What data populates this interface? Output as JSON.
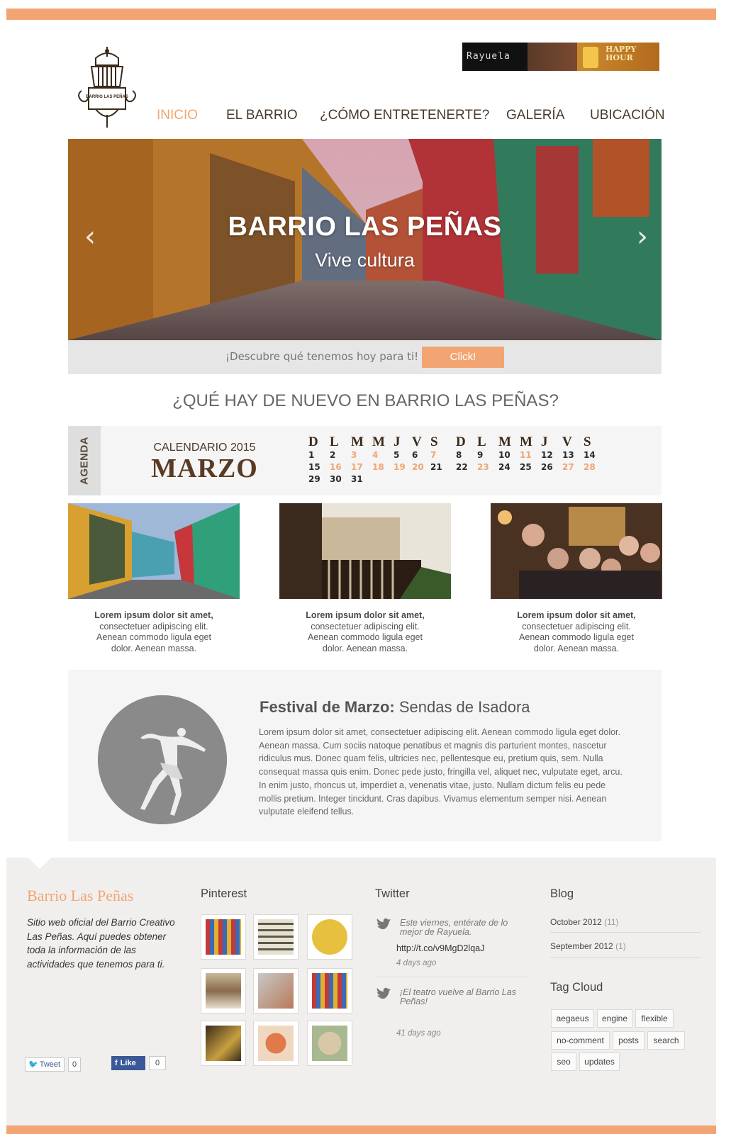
{
  "nav": {
    "items": [
      {
        "label": "INICIO",
        "active": true
      },
      {
        "label": "EL BARRIO",
        "active": false
      },
      {
        "label": "¿CÓMO ENTRETENERTE?",
        "active": false
      },
      {
        "label": "GALERÍA",
        "active": false
      },
      {
        "label": "UBICACIÓN",
        "active": false
      }
    ]
  },
  "logo": {
    "text": "BARRIO LAS PEÑAS"
  },
  "ad": {
    "brand": "Rayuela",
    "text": "HAPPY HOUR"
  },
  "hero": {
    "title": "BARRIO LAS PEÑAS",
    "subtitle": "Vive cultura",
    "prev_icon": "‹",
    "next_icon": "›"
  },
  "discover": {
    "text": "¡Descubre qué tenemos hoy para ti!",
    "button": "Click!"
  },
  "section_heading": "¿QUÉ HAY DE NUEVO EN BARRIO LAS PEÑAS?",
  "agenda": {
    "tab": "AGENDA",
    "label": "CALENDARIO 2015",
    "month": "MARZO",
    "weekdays": [
      "D",
      "L",
      "M",
      "M",
      "J",
      "V",
      "S",
      "D",
      "L",
      "M",
      "M",
      "J",
      "V",
      "S"
    ],
    "days": [
      1,
      2,
      3,
      4,
      5,
      6,
      7,
      8,
      9,
      10,
      11,
      12,
      13,
      14,
      15,
      16,
      17,
      18,
      19,
      20,
      21,
      22,
      23,
      24,
      25,
      26,
      27,
      28,
      29,
      30,
      31
    ],
    "highlighted_days": [
      3,
      4,
      7,
      11,
      16,
      17,
      18,
      19,
      20,
      23,
      27,
      28
    ],
    "highlight_color": "#f2a572"
  },
  "cards": [
    {
      "title": "Lorem ipsum dolor sit amet,",
      "lines": [
        "consectetuer adipiscing elit.",
        "Aenean commodo ligula eget",
        "dolor. Aenean massa."
      ]
    },
    {
      "title": "Lorem ipsum dolor sit amet,",
      "lines": [
        "consectetuer adipiscing elit.",
        "Aenean commodo ligula eget",
        "dolor. Aenean massa."
      ]
    },
    {
      "title": "Lorem ipsum dolor sit amet,",
      "lines": [
        "consectetuer adipiscing elit.",
        "Aenean commodo ligula eget",
        "dolor. Aenean massa."
      ]
    }
  ],
  "festival": {
    "title_bold": "Festival de Marzo:",
    "title_rest": " Sendas de Isadora",
    "body": "Lorem ipsum dolor sit amet, consectetuer adipiscing elit. Aenean commodo ligula eget dolor. Aenean massa. Cum sociis natoque penatibus et magnis dis parturient montes, nascetur ridiculus mus. Donec quam felis, ultricies nec, pellentesque eu, pretium quis, sem. Nulla consequat massa quis enim. Donec pede justo, fringilla vel, aliquet nec, vulputate eget, arcu. In enim justo, rhoncus ut, imperdiet a, venenatis vitae, justo. Nullam dictum felis eu pede mollis pretium. Integer tincidunt. Cras dapibus. Vivamus elementum semper nisi. Aenean vulputate eleifend tellus."
  },
  "footer": {
    "brand": "Barrio Las Peñas",
    "description": "Sitio web oficial del Barrio Creativo Las Peñas. Aquí puedes obtener toda la información de las actividades que tenemos para ti.",
    "tweet_label": "Tweet",
    "tweet_count": "0",
    "like_label": "Like",
    "like_count": "0",
    "pinterest_heading": "Pinterest",
    "twitter_heading": "Twitter",
    "tweets": [
      {
        "text": "Este viernes, entérate de lo mejor de Rayuela.",
        "link": "http://t.co/v9MgD2lqaJ",
        "time": "4 days ago"
      },
      {
        "text": "¡El teatro vuelve al Barrio Las Peñas!",
        "link": "",
        "time": "41 days ago"
      }
    ],
    "blog_heading": "Blog",
    "blog_links": [
      {
        "label": "October 2012",
        "count": "(11)"
      },
      {
        "label": "September 2012",
        "count": "(1)"
      }
    ],
    "tagcloud_heading": "Tag Cloud",
    "tags": [
      "aegaeus",
      "engine",
      "flexible",
      "no-comment",
      "posts",
      "search",
      "seo",
      "updates"
    ]
  },
  "colors": {
    "accent": "#f2a572",
    "footer_bg": "#f1efed",
    "brown": "#5a3a22"
  }
}
